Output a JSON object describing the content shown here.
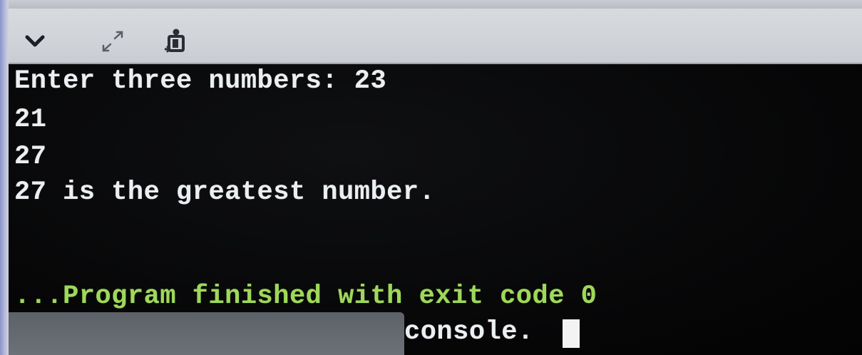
{
  "toolbar": {
    "icons": [
      "chevron-down-icon",
      "expand-icon",
      "clear-console-icon"
    ]
  },
  "console": {
    "lines": [
      "Enter three numbers: 23",
      "21",
      "27",
      "27 is the greatest number."
    ],
    "exit_message": "...Program finished with exit code 0",
    "partial_message": "console."
  },
  "colors": {
    "console_background": "#060607",
    "console_text": "#eceff2",
    "exit_text": "#9fd85a",
    "toolbar_background": "#d3d6da"
  }
}
